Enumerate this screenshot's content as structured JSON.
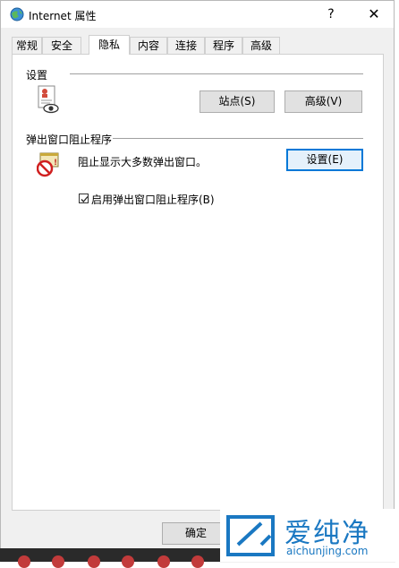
{
  "window": {
    "title": "Internet 属性",
    "help_label": "?",
    "close_label": "✕"
  },
  "tabs": [
    {
      "label": "常规"
    },
    {
      "label": "安全"
    },
    {
      "label": "隐私"
    },
    {
      "label": "内容"
    },
    {
      "label": "连接"
    },
    {
      "label": "程序"
    },
    {
      "label": "高级"
    }
  ],
  "active_tab": "隐私",
  "settings_group": {
    "label": "设置",
    "sites_button": "站点(S)",
    "advanced_button": "高级(V)"
  },
  "popup_group": {
    "label": "弹出窗口阻止程序",
    "description": "阻止显示大多数弹出窗口。",
    "settings_button": "设置(E)",
    "enable_checkbox_label": "启用弹出窗口阻止程序(B)",
    "enable_checked": true
  },
  "footer": {
    "ok_button": "确定"
  },
  "watermark": {
    "main": "爱纯净",
    "sub": "aichunjing.com"
  },
  "colors": {
    "accent": "#0078d7",
    "watermark": "#1a78c2"
  }
}
